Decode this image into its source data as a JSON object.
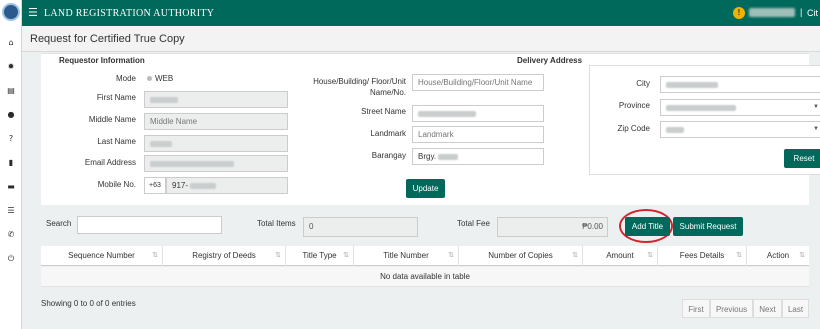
{
  "topbar": {
    "menu_icon": "hamburger-icon",
    "title": "LAND REGISTRATION AUTHORITY",
    "warning_icon": "warning-icon",
    "warning_glyph": "!",
    "separator": "|",
    "city_label": "Cit"
  },
  "sidebar": {
    "icons": [
      "home-icon",
      "sun-icon",
      "document-icon",
      "user-icon",
      "help-icon",
      "book-icon",
      "card-icon",
      "list-icon",
      "phone-icon",
      "power-icon"
    ]
  },
  "page": {
    "title": "Request for Certified True Copy"
  },
  "requestor": {
    "heading": "Requestor Information",
    "mode_label": "Mode",
    "mode_value": "WEB",
    "first_name_label": "First Name",
    "middle_name_label": "Middle Name",
    "middle_name_placeholder": "Middle Name",
    "last_name_label": "Last Name",
    "email_label": "Email Address",
    "mobile_label": "Mobile No.",
    "mobile_prefix": "+63",
    "mobile_value": "917-"
  },
  "delivery": {
    "heading": "Delivery Address",
    "house_label": "House/Building/ Floor/Unit Name/No.",
    "house_placeholder": "House/Building/Floor/Unit Name",
    "street_label": "Street Name",
    "landmark_label": "Landmark",
    "landmark_placeholder": "Landmark",
    "barangay_label": "Barangay",
    "barangay_value": "Brgy.",
    "city_label": "City",
    "province_label": "Province",
    "zip_label": "Zip Code",
    "reset_label": "Reset",
    "update_label": "Update"
  },
  "toolbar": {
    "search_label": "Search",
    "total_items_label": "Total Items",
    "total_items_value": "0",
    "total_fee_label": "Total Fee",
    "total_fee_value": "₱0.00",
    "add_title_label": "Add Title",
    "submit_label": "Submit Request",
    "highlight_color": "#d0272f"
  },
  "table": {
    "columns": [
      "Sequence Number",
      "Registry of Deeds",
      "Title Type",
      "Title Number",
      "Number of Copies",
      "Amount",
      "Fees Details",
      "Action"
    ],
    "empty_message": "No data available in table",
    "footer_info": "Showing 0 to 0 of 0 entries"
  },
  "pagination": {
    "first": "First",
    "previous": "Previous",
    "next": "Next",
    "last": "Last"
  },
  "colors": {
    "brand": "#00695c",
    "warning": "#f0b400"
  }
}
